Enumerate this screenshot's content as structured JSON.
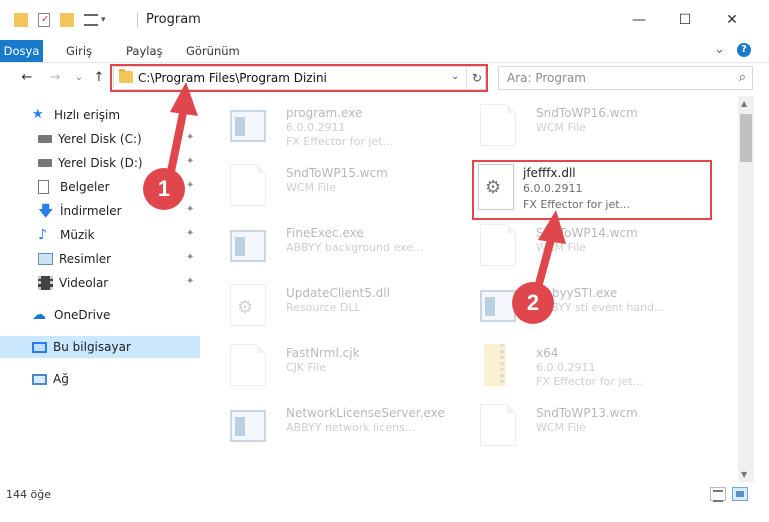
{
  "window": {
    "title": "Program",
    "controls": {
      "minimize": "—",
      "maximize": "☐",
      "close": "✕"
    }
  },
  "ribbon": {
    "tabs": [
      "Dosya",
      "Giriş",
      "Paylaş",
      "Görünüm"
    ],
    "expand_glyph": "⌄",
    "help_glyph": "?"
  },
  "address_bar": {
    "path": "C:\\Program Files\\Program Dizini",
    "dropdown_glyph": "⌄",
    "refresh_glyph": "↻"
  },
  "navigation": {
    "back": "←",
    "forward": "→",
    "recent": "⌄",
    "up": "↑"
  },
  "search": {
    "placeholder": "Ara: Program",
    "glyph": "⌕"
  },
  "sidebar": {
    "items": [
      {
        "label": "Hızlı erişim",
        "icon": "star-icon"
      },
      {
        "label": "Yerel Disk (C:)",
        "icon": "drive-icon"
      },
      {
        "label": "Yerel Disk (D:)",
        "icon": "drive-icon"
      },
      {
        "label": "Belgeler",
        "icon": "documents-icon"
      },
      {
        "label": "İndirmeler",
        "icon": "download-icon"
      },
      {
        "label": "Müzik",
        "icon": "music-icon"
      },
      {
        "label": "Resimler",
        "icon": "pictures-icon"
      },
      {
        "label": "Videolar",
        "icon": "video-icon"
      },
      {
        "label": "OneDrive",
        "icon": "cloud-icon"
      },
      {
        "label": "Bu bilgisayar",
        "icon": "computer-icon"
      },
      {
        "label": "Ağ",
        "icon": "network-icon"
      }
    ],
    "pin_glyph": "📌"
  },
  "files": [
    {
      "name": "program.exe",
      "line2": "6.0.0.2911",
      "line3": "FX Effector for jet...",
      "kind": "app"
    },
    {
      "name": "SndToWP16.wcm",
      "line2": "WCM File",
      "line3": "",
      "kind": "doc"
    },
    {
      "name": "SndToWP15.wcm",
      "line2": "WCM File",
      "line3": "",
      "kind": "doc"
    },
    {
      "name": "FineExec.exe",
      "line2": "ABBYY background exe...",
      "line3": "",
      "kind": "app"
    },
    {
      "name": "SndToWP14.wcm",
      "line2": "WCM File",
      "line3": "",
      "kind": "doc"
    },
    {
      "name": "UpdateClient5.dll",
      "line2": "Resource DLL",
      "line3": "",
      "kind": "gear"
    },
    {
      "name": "AbbyySTI.exe",
      "line2": "ABBYY sti event hand...",
      "line3": "",
      "kind": "app"
    },
    {
      "name": "FastNrml.cjk",
      "line2": "CJK File",
      "line3": "",
      "kind": "doc"
    },
    {
      "name": "x64",
      "line2": "6.0.0.2911",
      "line3": "FX Effector for jet...",
      "kind": "zip"
    },
    {
      "name": "NetworkLicenseServer.exe",
      "line2": "ABBYY network licens...",
      "line3": "",
      "kind": "app"
    },
    {
      "name": "SndToWP13.wcm",
      "line2": "WCM File",
      "line3": "",
      "kind": "doc"
    }
  ],
  "featured_file": {
    "name": "jfefffx.dll",
    "version": "6.0.0.2911",
    "description": "FX Effector for jet..."
  },
  "annotations": [
    {
      "number": "1"
    },
    {
      "number": "2"
    }
  ],
  "status_bar": {
    "item_count": "144 öğe"
  },
  "colors": {
    "accent": "#1979ca",
    "highlight": "#e0474c",
    "selection": "#cce8ff"
  }
}
